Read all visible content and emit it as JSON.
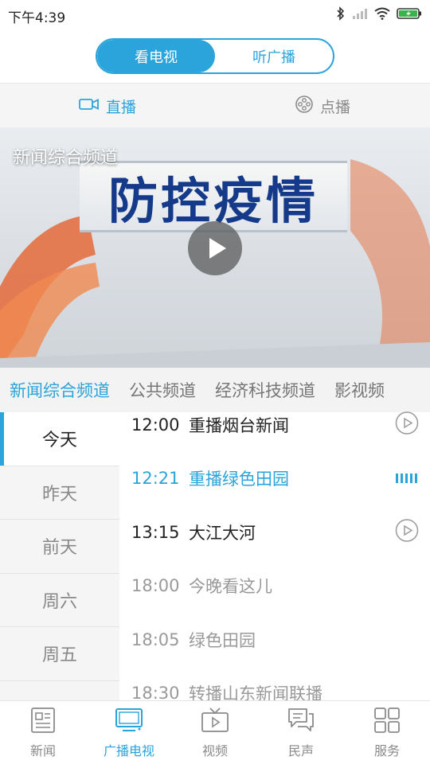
{
  "status": {
    "time": "下午4:39"
  },
  "switcher": {
    "options": [
      "看电视",
      "听广播"
    ],
    "active": 0
  },
  "mode_tabs": [
    {
      "label": "直播",
      "icon": "camera-icon",
      "active": true
    },
    {
      "label": "点播",
      "icon": "film-reel-icon",
      "active": false
    }
  ],
  "player": {
    "channel_title": "新闻综合频道",
    "banner_text": "防控疫情"
  },
  "channels": [
    "新闻综合频道",
    "公共频道",
    "经济科技频道",
    "影视频"
  ],
  "days": [
    "今天",
    "昨天",
    "前天",
    "周六",
    "周五"
  ],
  "programs": [
    {
      "time": "12:00",
      "name": "重播烟台新闻",
      "state": "past"
    },
    {
      "time": "12:21",
      "name": "重播绿色田园",
      "state": "current"
    },
    {
      "time": "13:15",
      "name": "大江大河",
      "state": "past"
    },
    {
      "time": "18:00",
      "name": "今晚看这儿",
      "state": "future"
    },
    {
      "time": "18:05",
      "name": "绿色田园",
      "state": "future"
    },
    {
      "time": "18:30",
      "name": "转播山东新闻联播",
      "state": "future"
    }
  ],
  "nav": [
    {
      "label": "新闻",
      "icon": "newspaper-icon"
    },
    {
      "label": "广播电视",
      "icon": "tv-icon"
    },
    {
      "label": "视频",
      "icon": "video-icon"
    },
    {
      "label": "民声",
      "icon": "chat-icon"
    },
    {
      "label": "服务",
      "icon": "grid-icon"
    }
  ],
  "colors": {
    "accent": "#2aa4da",
    "text": "#222222",
    "muted": "#8a8a8a"
  }
}
